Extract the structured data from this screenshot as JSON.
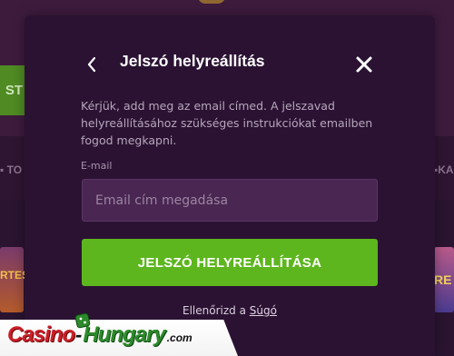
{
  "background": {
    "top_button_label": "ST",
    "nav_left_label": "TO",
    "nav_right_label": "KA",
    "thumb_left_label": "RTES",
    "thumb_right_label": "RE"
  },
  "modal": {
    "title": "Jelszó helyreállítás",
    "description": "Kérjük, add meg az email címed. A jelszavad helyreállításához szükséges instrukciókat emailben fogod megkapni.",
    "email_label": "E-mail",
    "email_placeholder": "Email cím megadása",
    "email_value": "",
    "submit_label": "JELSZÓ HELYREÁLLÍTÁSA",
    "help_prefix": "Ellenőrizd a",
    "help_link": "Súgó",
    "icons": {
      "back": "chevron-left-icon",
      "close": "close-icon"
    },
    "colors": {
      "modal_bg": "#2b1233",
      "input_bg": "#4a2652",
      "button_bg": "#5db61e",
      "text": "#ffffff"
    }
  },
  "watermark": {
    "casino": "Casino",
    "hungary": "Hungary",
    "domain": ".com"
  }
}
